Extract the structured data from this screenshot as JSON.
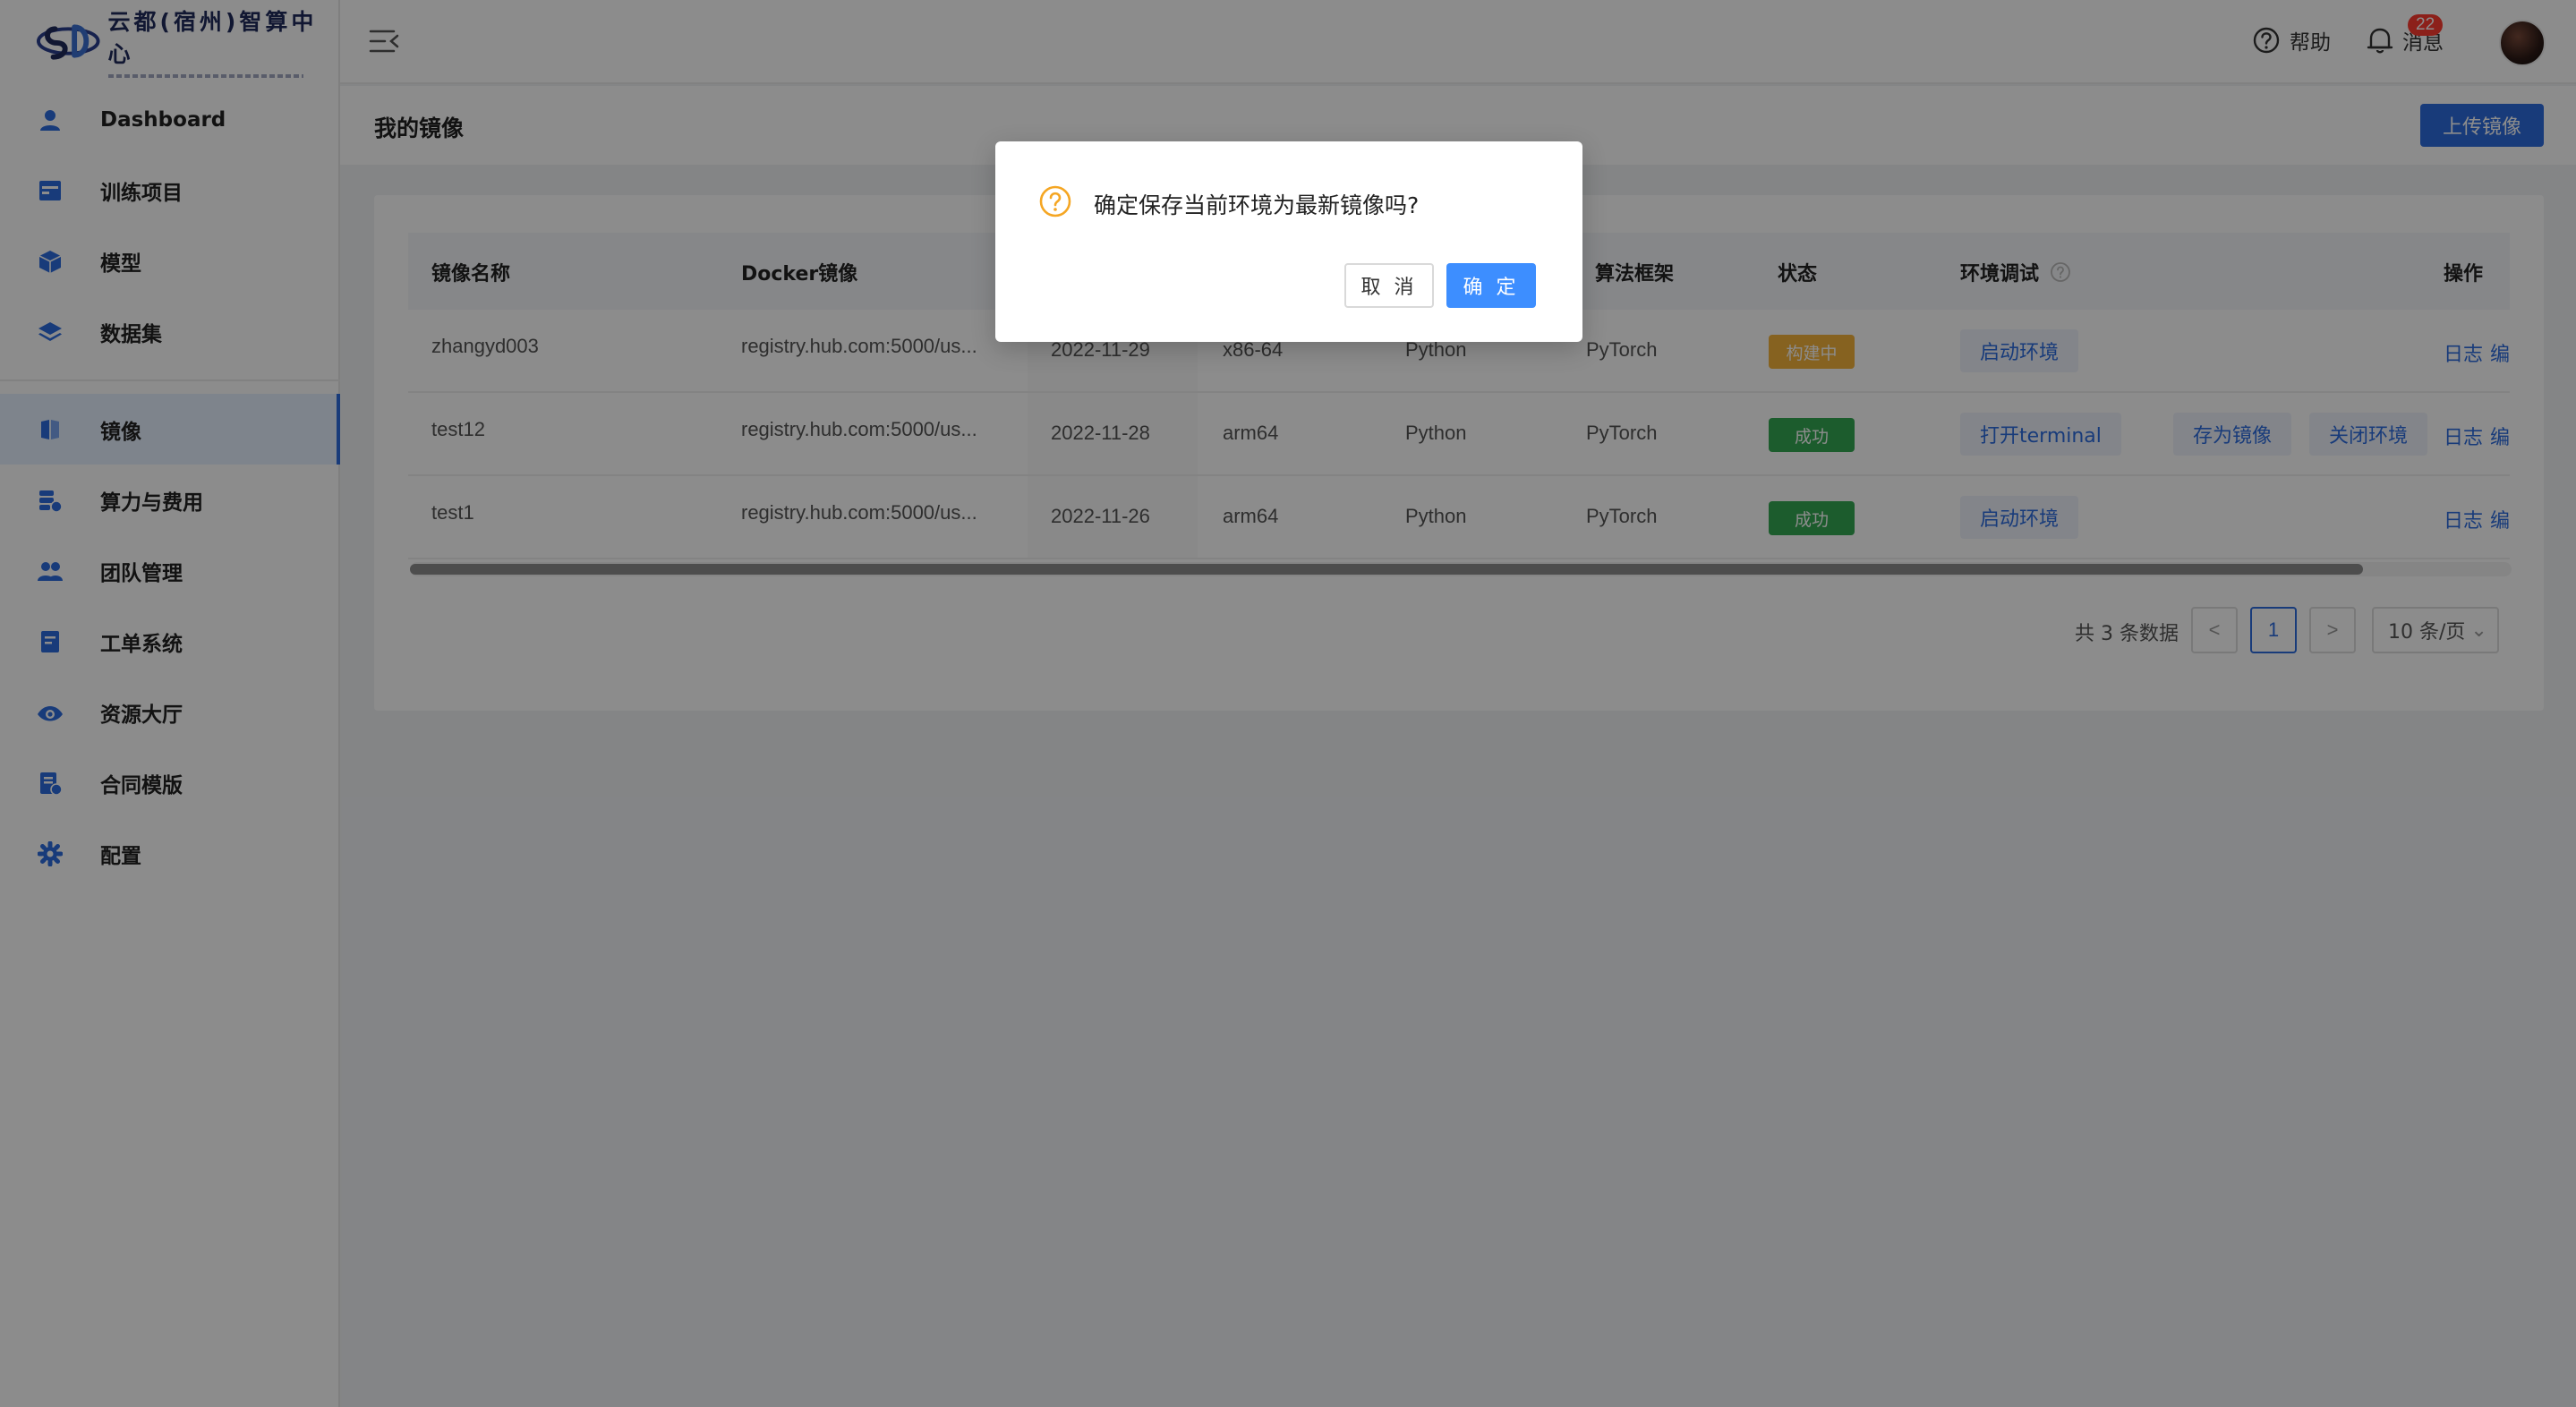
{
  "brand": {
    "name": "云都(宿州)智算中心"
  },
  "sidebar": {
    "items": [
      {
        "label": "Dashboard",
        "icon": "user-icon"
      },
      {
        "label": "训练项目",
        "icon": "project-icon"
      },
      {
        "label": "模型",
        "icon": "cube-icon"
      },
      {
        "label": "数据集",
        "icon": "layers-icon"
      },
      {
        "label": "镜像",
        "icon": "image-icon",
        "active": true
      },
      {
        "label": "算力与费用",
        "icon": "compute-cost-icon"
      },
      {
        "label": "团队管理",
        "icon": "team-icon"
      },
      {
        "label": "工单系统",
        "icon": "ticket-icon"
      },
      {
        "label": "资源大厅",
        "icon": "eye-icon"
      },
      {
        "label": "合同模版",
        "icon": "contract-icon"
      },
      {
        "label": "配置",
        "icon": "gear-icon"
      }
    ]
  },
  "header": {
    "help_label": "帮助",
    "messages_label": "消息",
    "messages_count": "22"
  },
  "page": {
    "title": "我的镜像",
    "upload_label": "上传镜像"
  },
  "table": {
    "columns": [
      "镜像名称",
      "Docker镜像",
      "算法框架",
      "状态",
      "环境调试",
      "操作"
    ],
    "rows": [
      {
        "name": "zhangyd003",
        "docker": "registry.hub.com:5000/us...",
        "date": "2022-11-29",
        "arch": "x86-64",
        "lang": "Python",
        "framework": "PyTorch",
        "status": "构建中",
        "actions": [
          "启动环境"
        ],
        "ops": [
          "日志",
          "编"
        ]
      },
      {
        "name": "test12",
        "docker": "registry.hub.com:5000/us...",
        "date": "2022-11-28",
        "arch": "arm64",
        "lang": "Python",
        "framework": "PyTorch",
        "status": "成功",
        "actions": [
          "打开terminal",
          "存为镜像",
          "关闭环境"
        ],
        "ops": [
          "日志",
          "编"
        ]
      },
      {
        "name": "test1",
        "docker": "registry.hub.com:5000/us...",
        "date": "2022-11-26",
        "arch": "arm64",
        "lang": "Python",
        "framework": "PyTorch",
        "status": "成功",
        "actions": [
          "启动环境"
        ],
        "ops": [
          "日志",
          "编"
        ]
      }
    ]
  },
  "pagination": {
    "total_label": "共 3 条数据",
    "prev": "<",
    "current": "1",
    "next": ">",
    "page_size": "10 条/页"
  },
  "modal": {
    "message": "确定保存当前环境为最新镜像吗?",
    "cancel_label": "取 消",
    "ok_label": "确 定"
  },
  "colors": {
    "primary": "#2d6cdf",
    "warning": "#f5b33b",
    "success": "#34a853",
    "badge": "#ff3b30"
  }
}
